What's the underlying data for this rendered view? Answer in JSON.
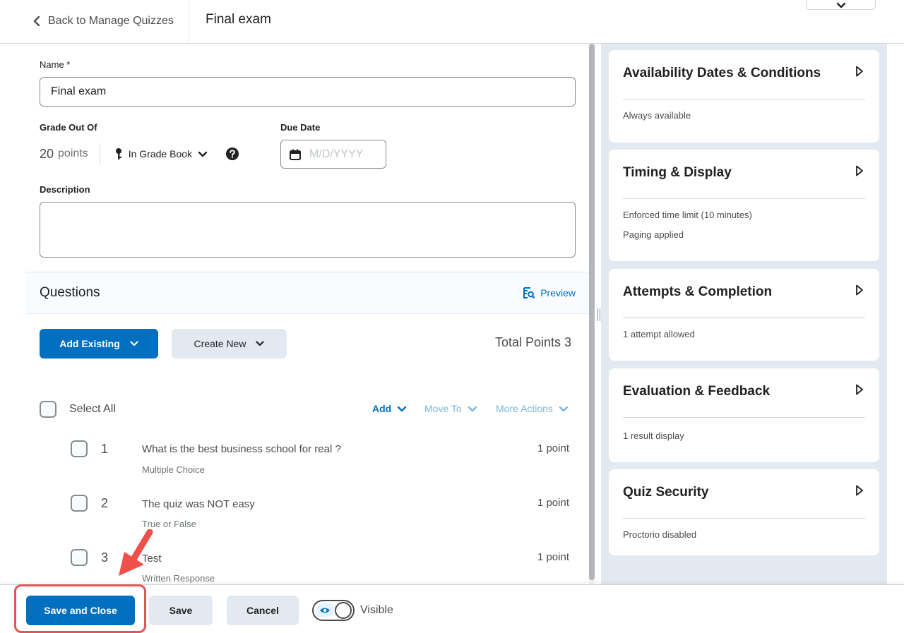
{
  "header": {
    "back_label": "Back to Manage Quizzes",
    "title": "Final exam"
  },
  "form": {
    "name_label": "Name *",
    "name_value": "Final exam",
    "grade_label": "Grade Out Of",
    "grade_value": "20",
    "grade_unit": "points",
    "gradebook_label": "In Grade Book",
    "due_label": "Due Date",
    "due_placeholder": "M/D/YYYY",
    "description_label": "Description",
    "description_value": ""
  },
  "questions": {
    "title": "Questions",
    "preview_label": "Preview",
    "add_existing_label": "Add Existing",
    "create_new_label": "Create New",
    "total_points": "Total Points 3",
    "select_all_label": "Select All",
    "actions": {
      "add": "Add",
      "move_to": "Move To",
      "more_actions": "More Actions"
    },
    "items": [
      {
        "num": "1",
        "title": "What is the best business school for real ?",
        "type": "Multiple Choice",
        "points": "1 point"
      },
      {
        "num": "2",
        "title": "The quiz was NOT easy",
        "type": "True or False",
        "points": "1 point"
      },
      {
        "num": "3",
        "title": "Test",
        "type": "Written Response",
        "points": "1 point"
      }
    ]
  },
  "side": {
    "cards": [
      {
        "title": "Availability Dates & Conditions",
        "lines": [
          "Always available"
        ]
      },
      {
        "title": "Timing & Display",
        "lines": [
          "Enforced time limit (10 minutes)",
          "Paging applied"
        ]
      },
      {
        "title": "Attempts & Completion",
        "lines": [
          "1 attempt allowed"
        ]
      },
      {
        "title": "Evaluation & Feedback",
        "lines": [
          "1 result display"
        ]
      },
      {
        "title": "Quiz Security",
        "lines": [
          "Proctorio disabled"
        ]
      }
    ]
  },
  "footer": {
    "save_close_label": "Save and Close",
    "save_label": "Save",
    "cancel_label": "Cancel",
    "visible_label": "Visible"
  },
  "colors": {
    "primary": "#006fbf",
    "secondary": "#e3e9f1",
    "annotation": "#e05656"
  }
}
